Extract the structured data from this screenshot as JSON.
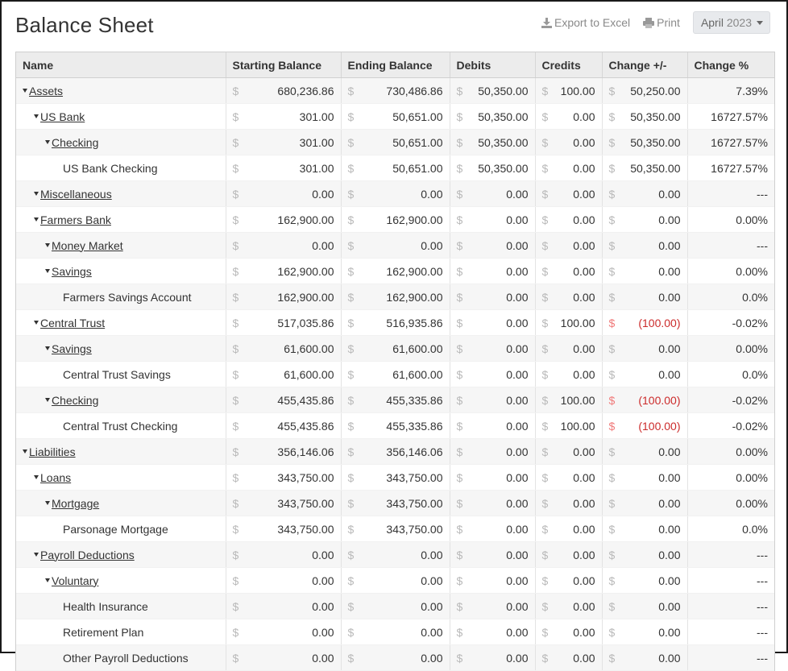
{
  "page": {
    "title": "Balance Sheet",
    "export_label": "Export to Excel",
    "print_label": "Print",
    "month": "April",
    "year": "2023"
  },
  "columns": [
    "Name",
    "Starting Balance",
    "Ending Balance",
    "Debits",
    "Credits",
    "Change +/-",
    "Change %"
  ],
  "currency_symbol": "$",
  "rows": [
    {
      "name": "Assets",
      "level": 0,
      "group": true,
      "start": "680,236.86",
      "end": "730,486.86",
      "debits": "50,350.00",
      "credits": "100.00",
      "change": "50,250.00",
      "pct": "7.39%"
    },
    {
      "name": "US Bank",
      "level": 1,
      "group": true,
      "start": "301.00",
      "end": "50,651.00",
      "debits": "50,350.00",
      "credits": "0.00",
      "change": "50,350.00",
      "pct": "16727.57%"
    },
    {
      "name": "Checking",
      "level": 2,
      "group": true,
      "start": "301.00",
      "end": "50,651.00",
      "debits": "50,350.00",
      "credits": "0.00",
      "change": "50,350.00",
      "pct": "16727.57%"
    },
    {
      "name": "US Bank Checking",
      "level": 3,
      "group": false,
      "start": "301.00",
      "end": "50,651.00",
      "debits": "50,350.00",
      "credits": "0.00",
      "change": "50,350.00",
      "pct": "16727.57%"
    },
    {
      "name": "Miscellaneous",
      "level": 1,
      "group": true,
      "start": "0.00",
      "end": "0.00",
      "debits": "0.00",
      "credits": "0.00",
      "change": "0.00",
      "pct": "---"
    },
    {
      "name": "Farmers Bank",
      "level": 1,
      "group": true,
      "start": "162,900.00",
      "end": "162,900.00",
      "debits": "0.00",
      "credits": "0.00",
      "change": "0.00",
      "pct": "0.00%"
    },
    {
      "name": "Money Market",
      "level": 2,
      "group": true,
      "start": "0.00",
      "end": "0.00",
      "debits": "0.00",
      "credits": "0.00",
      "change": "0.00",
      "pct": "---"
    },
    {
      "name": "Savings",
      "level": 2,
      "group": true,
      "start": "162,900.00",
      "end": "162,900.00",
      "debits": "0.00",
      "credits": "0.00",
      "change": "0.00",
      "pct": "0.00%"
    },
    {
      "name": "Farmers Savings Account",
      "level": 3,
      "group": false,
      "start": "162,900.00",
      "end": "162,900.00",
      "debits": "0.00",
      "credits": "0.00",
      "change": "0.00",
      "pct": "0.0%"
    },
    {
      "name": "Central Trust",
      "level": 1,
      "group": true,
      "start": "517,035.86",
      "end": "516,935.86",
      "debits": "0.00",
      "credits": "100.00",
      "change": "(100.00)",
      "negative": true,
      "pct": "-0.02%"
    },
    {
      "name": "Savings",
      "level": 2,
      "group": true,
      "start": "61,600.00",
      "end": "61,600.00",
      "debits": "0.00",
      "credits": "0.00",
      "change": "0.00",
      "pct": "0.00%"
    },
    {
      "name": "Central Trust Savings",
      "level": 3,
      "group": false,
      "start": "61,600.00",
      "end": "61,600.00",
      "debits": "0.00",
      "credits": "0.00",
      "change": "0.00",
      "pct": "0.0%"
    },
    {
      "name": "Checking",
      "level": 2,
      "group": true,
      "start": "455,435.86",
      "end": "455,335.86",
      "debits": "0.00",
      "credits": "100.00",
      "change": "(100.00)",
      "negative": true,
      "pct": "-0.02%"
    },
    {
      "name": "Central Trust Checking",
      "level": 3,
      "group": false,
      "start": "455,435.86",
      "end": "455,335.86",
      "debits": "0.00",
      "credits": "100.00",
      "change": "(100.00)",
      "negative": true,
      "pct": "-0.02%"
    },
    {
      "name": "Liabilities",
      "level": 0,
      "group": true,
      "start": "356,146.06",
      "end": "356,146.06",
      "debits": "0.00",
      "credits": "0.00",
      "change": "0.00",
      "pct": "0.00%"
    },
    {
      "name": "Loans",
      "level": 1,
      "group": true,
      "start": "343,750.00",
      "end": "343,750.00",
      "debits": "0.00",
      "credits": "0.00",
      "change": "0.00",
      "pct": "0.00%"
    },
    {
      "name": "Mortgage",
      "level": 2,
      "group": true,
      "start": "343,750.00",
      "end": "343,750.00",
      "debits": "0.00",
      "credits": "0.00",
      "change": "0.00",
      "pct": "0.00%"
    },
    {
      "name": "Parsonage Mortgage",
      "level": 3,
      "group": false,
      "start": "343,750.00",
      "end": "343,750.00",
      "debits": "0.00",
      "credits": "0.00",
      "change": "0.00",
      "pct": "0.0%"
    },
    {
      "name": "Payroll Deductions",
      "level": 1,
      "group": true,
      "start": "0.00",
      "end": "0.00",
      "debits": "0.00",
      "credits": "0.00",
      "change": "0.00",
      "pct": "---"
    },
    {
      "name": "Voluntary",
      "level": 2,
      "group": true,
      "start": "0.00",
      "end": "0.00",
      "debits": "0.00",
      "credits": "0.00",
      "change": "0.00",
      "pct": "---"
    },
    {
      "name": "Health Insurance",
      "level": 3,
      "group": false,
      "start": "0.00",
      "end": "0.00",
      "debits": "0.00",
      "credits": "0.00",
      "change": "0.00",
      "pct": "---"
    },
    {
      "name": "Retirement Plan",
      "level": 3,
      "group": false,
      "start": "0.00",
      "end": "0.00",
      "debits": "0.00",
      "credits": "0.00",
      "change": "0.00",
      "pct": "---"
    },
    {
      "name": "Other Payroll Deductions",
      "level": 3,
      "group": false,
      "start": "0.00",
      "end": "0.00",
      "debits": "0.00",
      "credits": "0.00",
      "change": "0.00",
      "pct": "---"
    }
  ]
}
